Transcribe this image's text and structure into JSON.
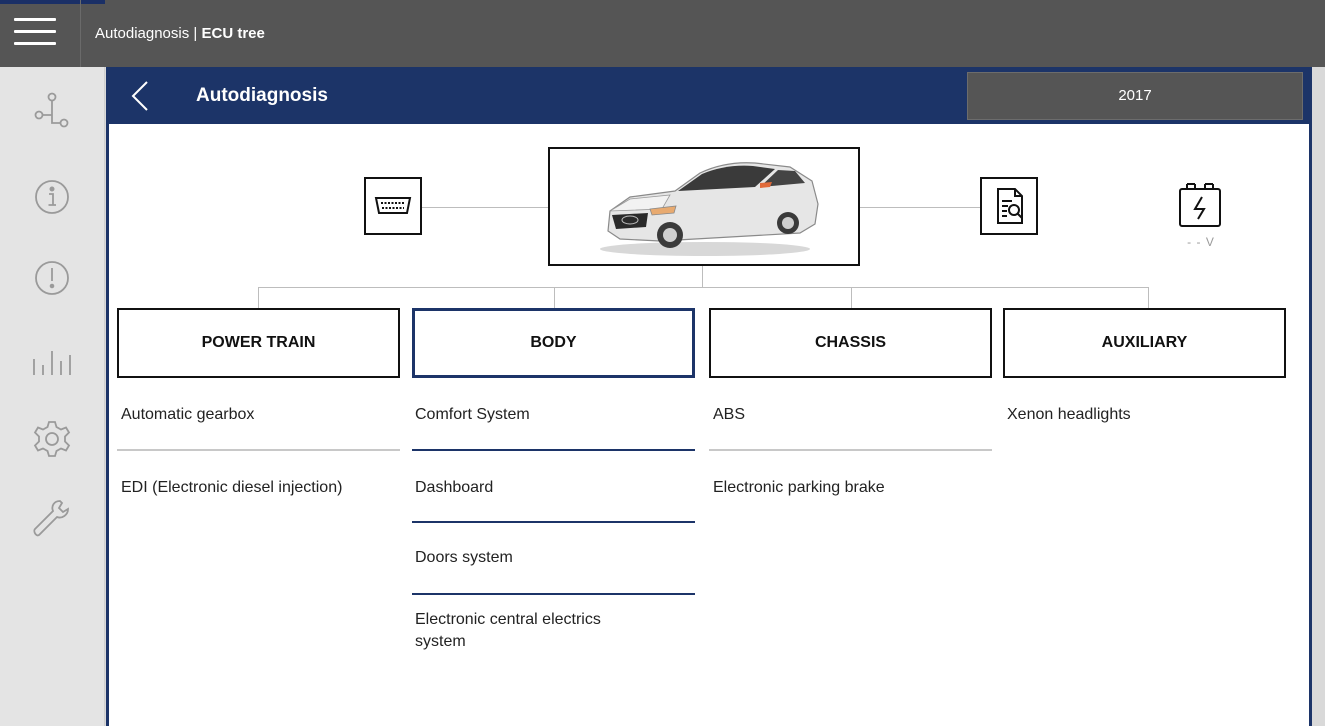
{
  "topbar": {
    "section": "Autodiagnosis |",
    "page": "ECU tree",
    "menu_icon": "hamburger-menu-icon"
  },
  "sidebar": {
    "items": [
      {
        "icon": "ecu-tree-icon"
      },
      {
        "icon": "info-icon"
      },
      {
        "icon": "warning-icon"
      },
      {
        "icon": "live-data-icon"
      },
      {
        "icon": "settings-icon"
      },
      {
        "icon": "wrench-icon"
      }
    ]
  },
  "header": {
    "title": "Autodiagnosis",
    "year": "2017",
    "back_icon": "chevron-left-icon"
  },
  "vehicle": {
    "connector_icon": "obd-connector-icon",
    "report_icon": "report-search-icon",
    "battery_icon": "battery-icon",
    "voltage": "- - V"
  },
  "categories": [
    {
      "label": "POWER TRAIN",
      "items": [
        "Automatic gearbox",
        "EDI (Electronic diesel injection)"
      ]
    },
    {
      "label": "BODY",
      "items": [
        "Comfort System",
        "Dashboard",
        "Doors system",
        "Electronic central electrics system"
      ]
    },
    {
      "label": "CHASSIS",
      "items": [
        "ABS",
        "Electronic parking brake"
      ]
    },
    {
      "label": "AUXILIARY",
      "items": [
        "Xenon headlights"
      ]
    }
  ],
  "colors": {
    "accent": "#1c3468",
    "topbar": "#555555",
    "sidebar": "#e4e4e4"
  }
}
